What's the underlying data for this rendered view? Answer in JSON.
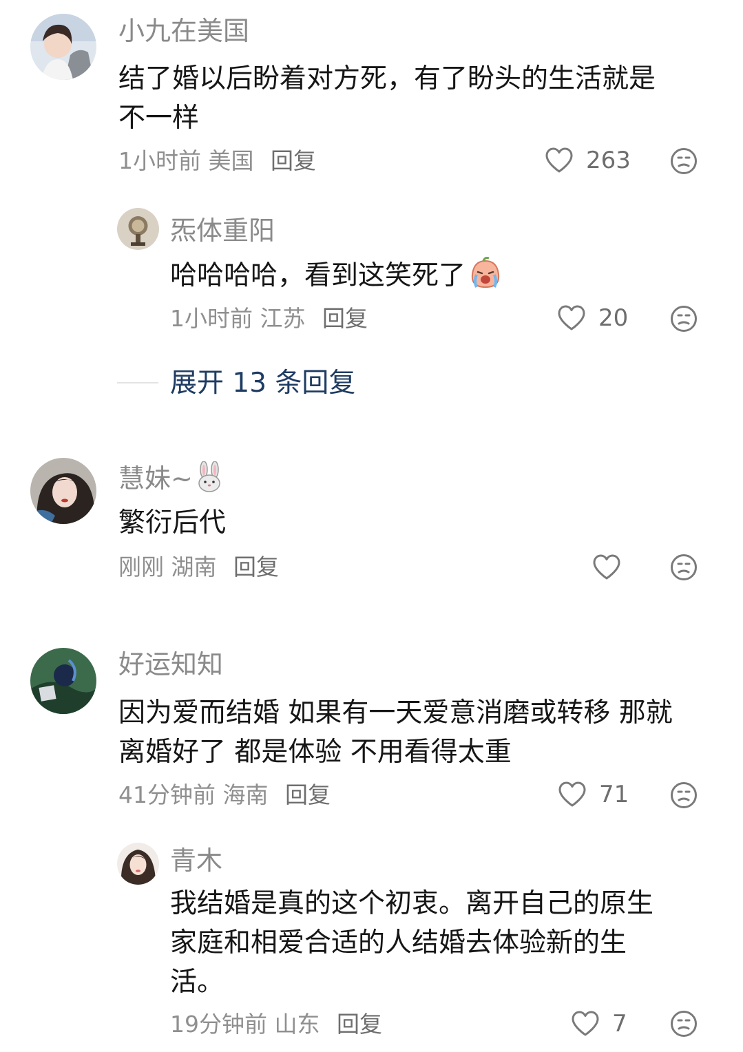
{
  "comments": [
    {
      "username": "小九在美国",
      "content_lines": [
        "结了婚以后盼着对方死，有了盼头的生活就是",
        "不一样"
      ],
      "time": "1小时前",
      "location": "美国",
      "reply_label": "回复",
      "likes": "263"
    },
    {
      "username": "炁体重阳",
      "content_lines": [
        "哈哈哈哈，看到这笑死了"
      ],
      "content_emoji": "crying-laugh-sticker",
      "time": "1小时前",
      "location": "江苏",
      "reply_label": "回复",
      "likes": "20"
    },
    {
      "username": "慧妹~",
      "username_emoji": "rabbit-face",
      "content_lines": [
        "繁衍后代"
      ],
      "time": "刚刚",
      "location": "湖南",
      "reply_label": "回复",
      "likes": ""
    },
    {
      "username": "好运知知",
      "content_lines": [
        "因为爱而结婚 如果有一天爱意消磨或转移 那就",
        "离婚好了 都是体验 不用看得太重"
      ],
      "time": "41分钟前",
      "location": "海南",
      "reply_label": "回复",
      "likes": "71"
    },
    {
      "username": "青木",
      "content_lines": [
        "我结婚是真的这个初衷。离开自己的原生",
        "家庭和相爱合适的人结婚去体验新的生",
        "活。"
      ],
      "time": "19分钟前",
      "location": "山东",
      "reply_label": "回复",
      "likes": "7"
    }
  ],
  "expand": {
    "label": "展开 13 条回复"
  },
  "colors": {
    "username": "#8a8a8a",
    "text": "#161616",
    "meta": "#8f8f8f",
    "expand_link": "#1f3c63",
    "icon_stroke": "#7a7a7a"
  }
}
